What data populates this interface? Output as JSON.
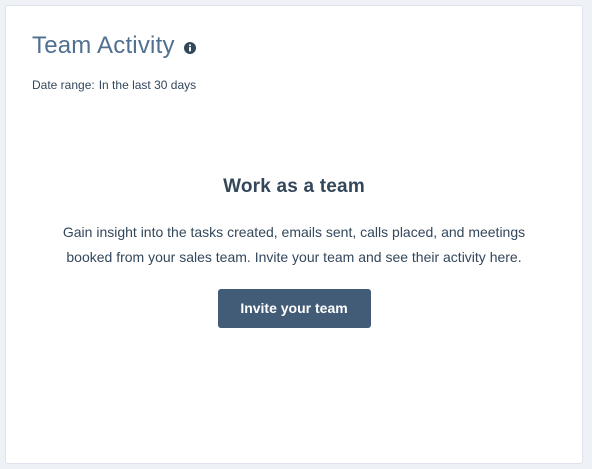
{
  "card": {
    "title": "Team Activity",
    "info_icon": "info-circle-icon",
    "date_range_label": "Date range:",
    "date_range_value": "In the last 30 days"
  },
  "empty_state": {
    "heading": "Work as a team",
    "body": "Gain insight into the tasks created, emails sent, calls placed, and meetings booked from your sales team. Invite your team and see their activity here.",
    "button_label": "Invite your team"
  },
  "colors": {
    "title": "#516f90",
    "text": "#33475b",
    "button_bg": "#425b76",
    "button_text": "#ffffff",
    "card_bg": "#ffffff",
    "page_bg": "#eef1f5"
  }
}
